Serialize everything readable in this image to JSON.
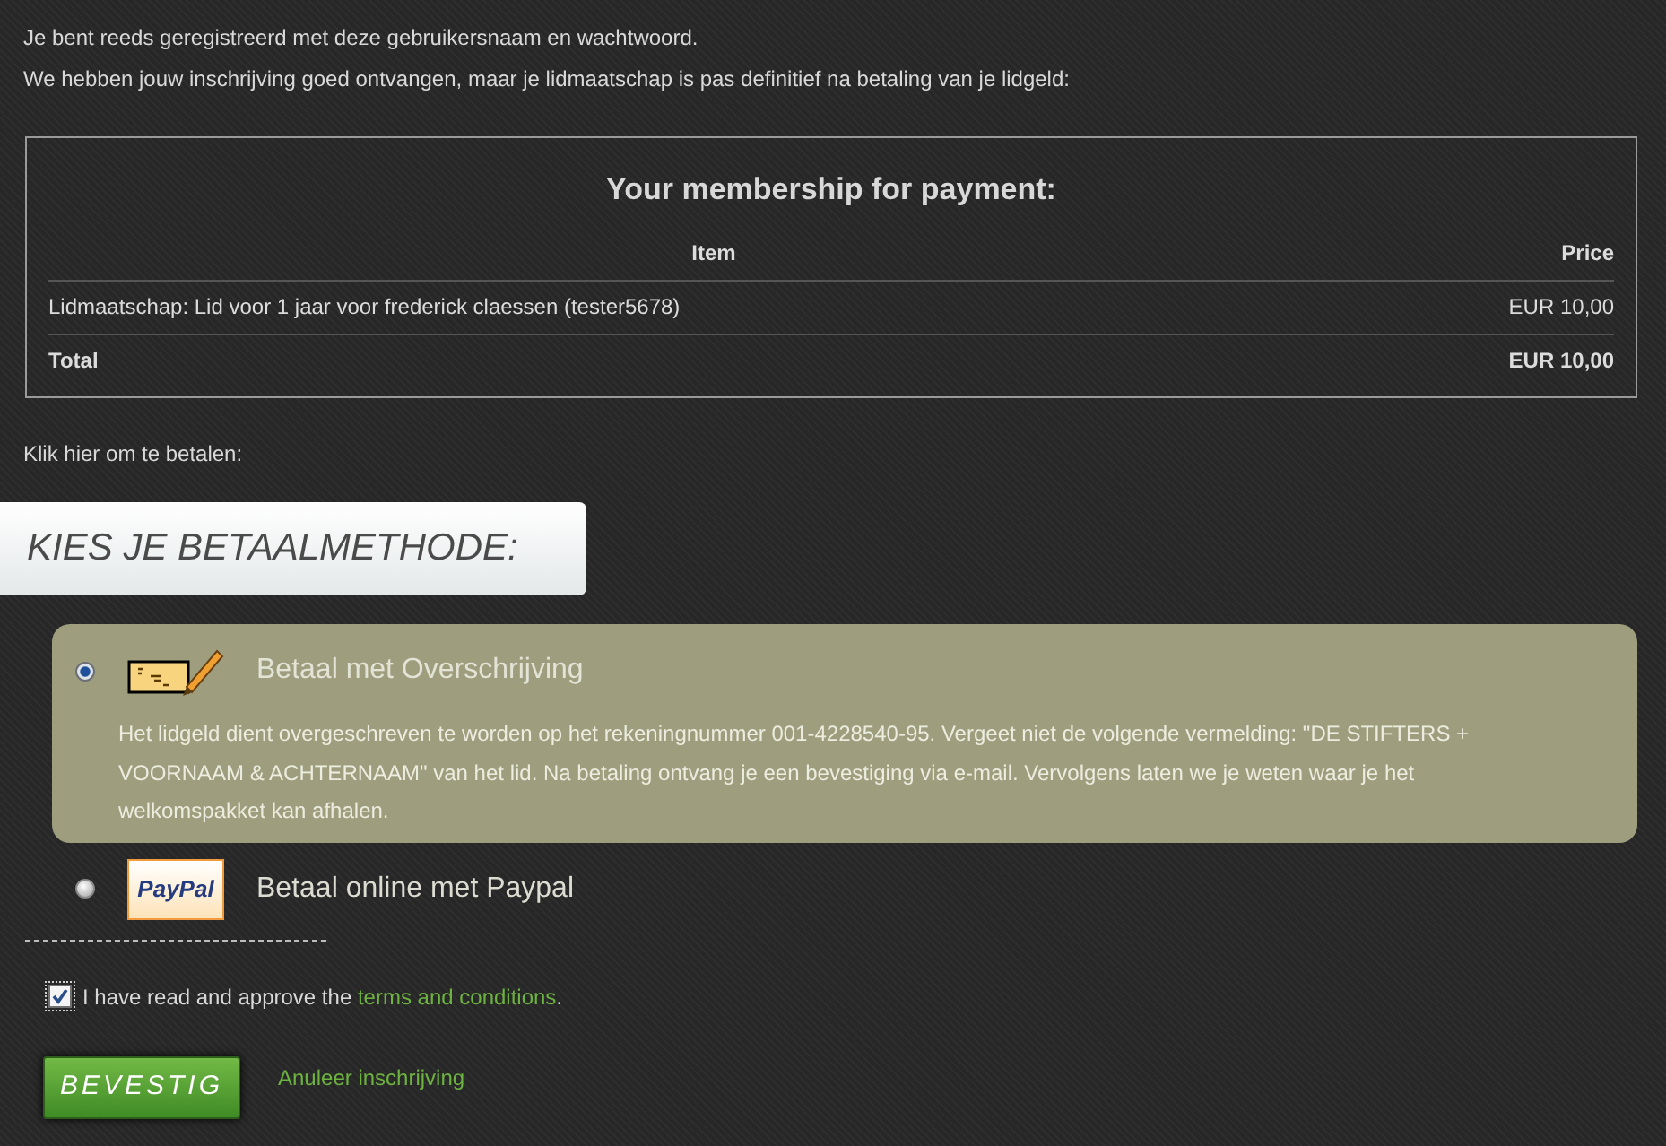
{
  "intro": [
    "Je bent reeds geregistreerd met deze gebruikersnaam en wachtwoord.",
    "We hebben jouw inschrijving goed ontvangen, maar je lidmaatschap is pas definitief na betaling van je lidgeld:"
  ],
  "membership": {
    "title": "Your membership for payment:",
    "columns": [
      "Item",
      "Price"
    ],
    "rows": [
      {
        "kind": "item",
        "cells": [
          "Lidmaatschap: Lid voor 1 jaar voor frederick claessen (tester5678)",
          "EUR 10,00"
        ]
      },
      {
        "kind": "total",
        "cells": [
          "Total",
          "EUR 10,00"
        ]
      }
    ]
  },
  "pay_prompt": "Klik hier om te betalen:",
  "method_heading": "KIES JE BETAALMETHODE:",
  "methods": [
    {
      "kind": "transfer",
      "selected": true,
      "label": "Betaal met Overschrijving",
      "description": "Het lidgeld dient overgeschreven te worden op het rekeningnummer 001-4228540-95. Vergeet niet de volgende vermelding: \"DE STIFTERS + VOORNAAM & ACHTERNAAM\" van het lid. Na betaling ontvang je een bevestiging via e-mail. Vervolgens laten we je weten waar je het welkomspakket kan afhalen."
    },
    {
      "kind": "paypal",
      "selected": false,
      "label": "Betaal online met Paypal",
      "logo_text": "PayPal"
    }
  ],
  "terms": {
    "checked": true,
    "text": "I have read and approve the ",
    "link": "terms and conditions",
    "after": "."
  },
  "confirm_button": "BEVESTIG",
  "cancel_link": "Anuleer inschrijving"
}
